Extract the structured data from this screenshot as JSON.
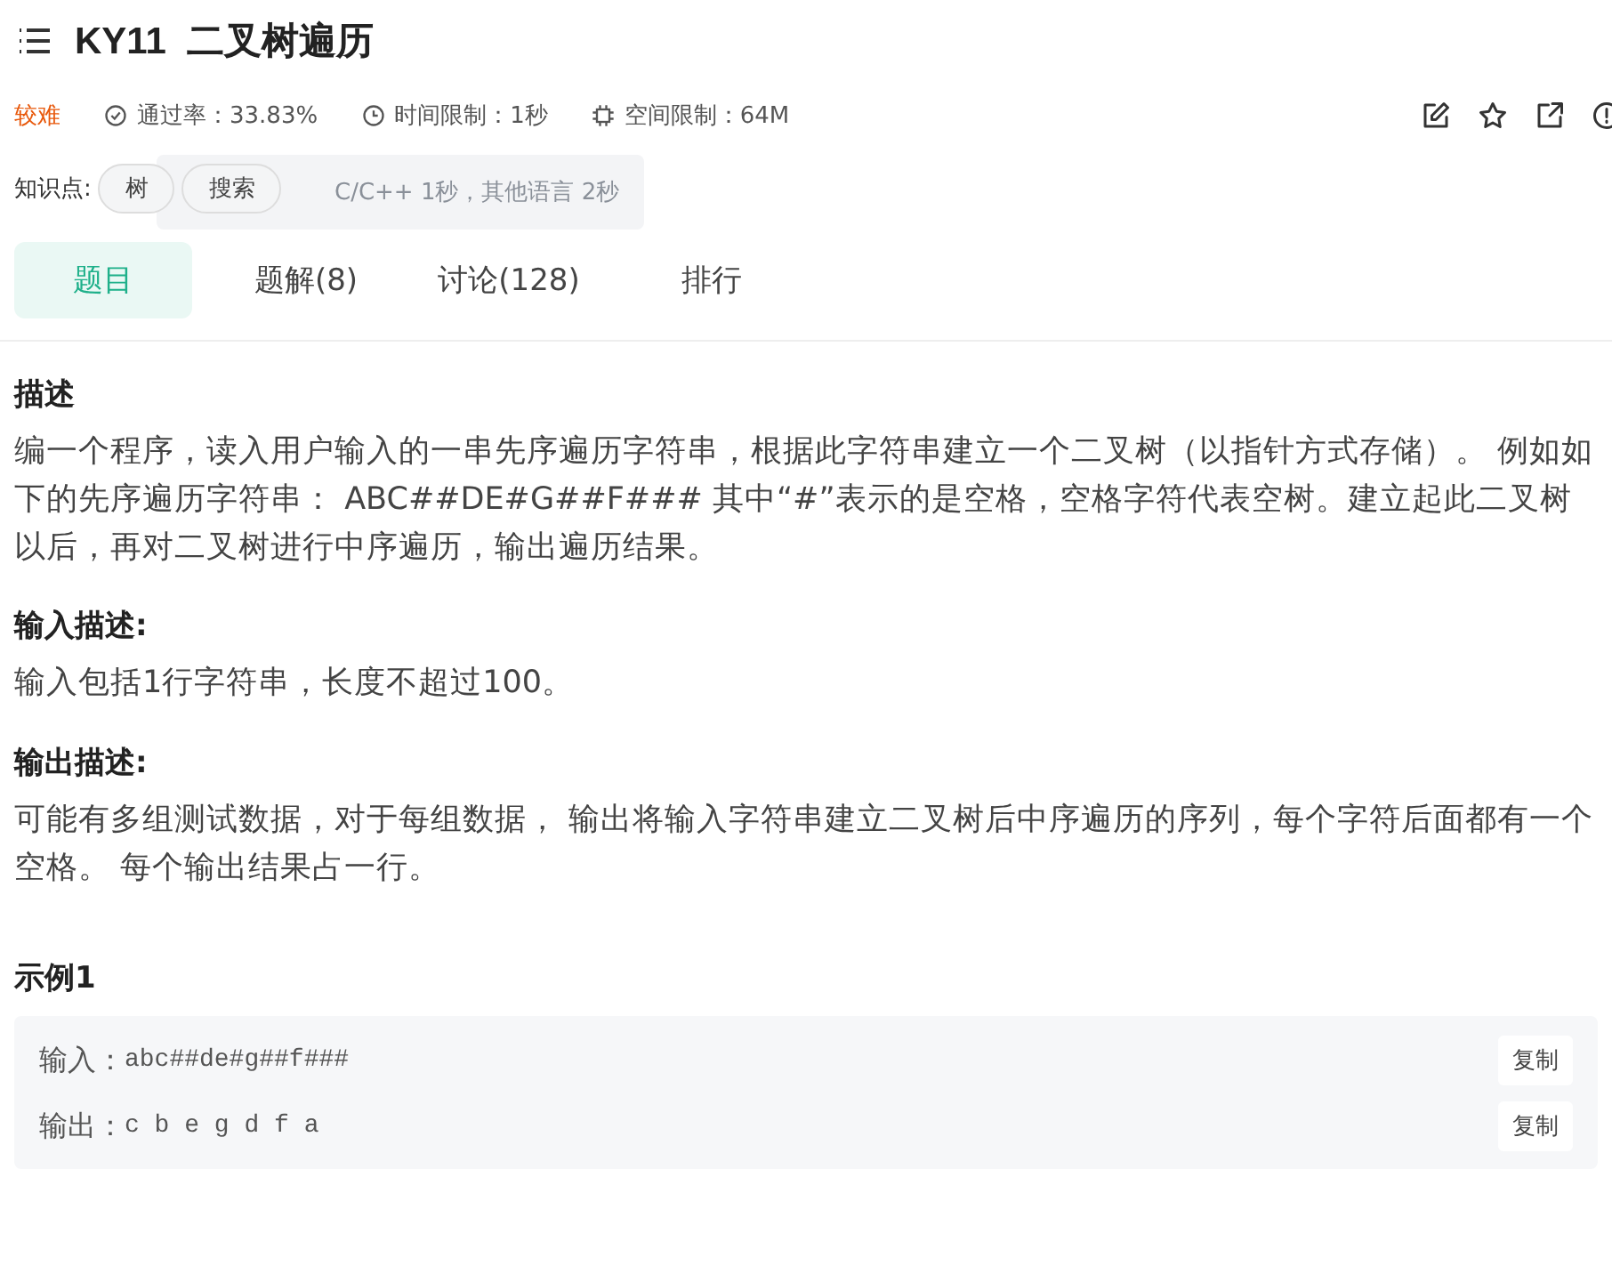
{
  "header": {
    "title": "KY11  二叉树遍历"
  },
  "meta": {
    "difficulty": "较难",
    "pass_rate": "通过率：33.83%",
    "time_limit": "时间限制：1秒",
    "space_limit": "空间限制：64M"
  },
  "tooltip": {
    "text": "C/C++ 1秒，其他语言 2秒"
  },
  "knowledge": {
    "label": "知识点:",
    "tags": [
      "树",
      "搜索"
    ]
  },
  "tabs": [
    {
      "label": "题目",
      "selected": true
    },
    {
      "label": "题解(8)",
      "selected": false
    },
    {
      "label": "讨论(128)",
      "selected": false
    },
    {
      "label": "排行",
      "selected": false
    }
  ],
  "sections": [
    {
      "heading": "描述",
      "body": "编一个程序，读入用户输入的一串先序遍历字符串，根据此字符串建立一个二叉树（以指针方式存储）。 例如如下的先序遍历字符串： ABC##DE#G##F### 其中“#”表示的是空格，空格字符代表空树。建立起此二叉树以后，再对二叉树进行中序遍历，输出遍历结果。"
    },
    {
      "heading": "输入描述:",
      "body": "输入包括1行字符串，长度不超过100。"
    },
    {
      "heading": "输出描述:",
      "body": "可能有多组测试数据，对于每组数据， 输出将输入字符串建立二叉树后中序遍历的序列，每个字符后面都有一个空格。 每个输出结果占一行。"
    }
  ],
  "example": {
    "title": "示例1",
    "lines": [
      {
        "label": "输入：",
        "value": "abc##de#g##f###",
        "button": "复制"
      },
      {
        "label": "输出：",
        "value": "c b e g d f a",
        "button": "复制"
      }
    ]
  }
}
